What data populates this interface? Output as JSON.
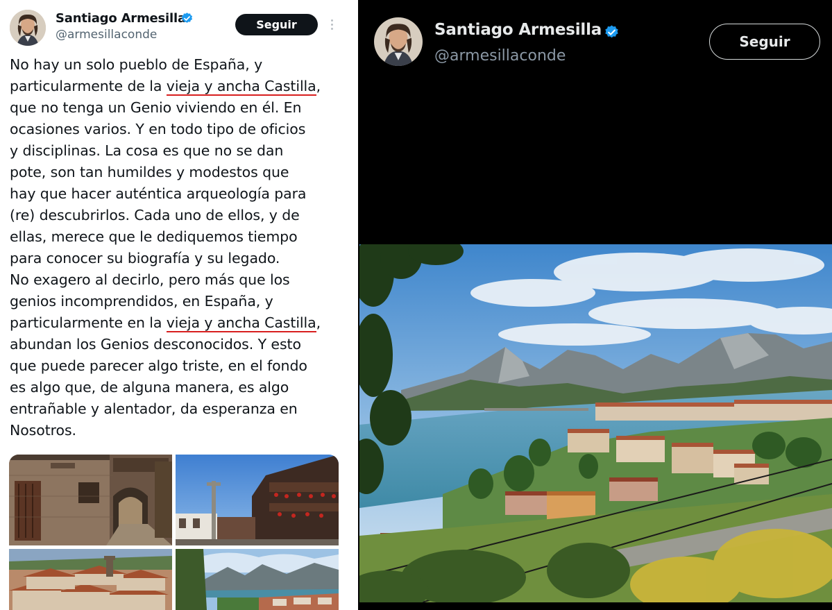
{
  "left_tweet": {
    "author_name": "Santiago Armesilla",
    "handle": "@armesillaconde",
    "follow_label": "Seguir",
    "text_lines": [
      {
        "a": "No hay un solo pueblo de España, y",
        "u": "",
        "b": ""
      },
      {
        "a": "particularmente de la ",
        "u": "vieja y ancha Castilla",
        "b": ","
      },
      {
        "a": "que no tenga un Genio viviendo en él. En",
        "u": "",
        "b": ""
      },
      {
        "a": "ocasiones varios. Y en todo tipo de oficios",
        "u": "",
        "b": ""
      },
      {
        "a": "y disciplinas. La cosa es que no se dan",
        "u": "",
        "b": ""
      },
      {
        "a": "pote, son tan humildes y modestos que",
        "u": "",
        "b": ""
      },
      {
        "a": "hay que hacer auténtica arqueología para",
        "u": "",
        "b": ""
      },
      {
        "a": "(re) descubrirlos. Cada uno de ellos, y de",
        "u": "",
        "b": ""
      },
      {
        "a": "ellas, merece que le dediquemos tiempo",
        "u": "",
        "b": ""
      },
      {
        "a": "para conocer su biografía y su legado.",
        "u": "",
        "b": ""
      },
      {
        "a": "No exagero al decirlo, pero más que los",
        "u": "",
        "b": ""
      },
      {
        "a": "genios incomprendidos, en España, y",
        "u": "",
        "b": ""
      },
      {
        "a": "particularmente en la ",
        "u": "vieja y ancha Castilla",
        "b": ","
      },
      {
        "a": "abundan los Genios desconocidos. Y esto",
        "u": "",
        "b": ""
      },
      {
        "a": "que puede parecer algo triste, en el fondo",
        "u": "",
        "b": ""
      },
      {
        "a": "es algo que, de alguna manera, es algo",
        "u": "",
        "b": ""
      },
      {
        "a": "entrañable y alentador, da esperanza en",
        "u": "",
        "b": ""
      },
      {
        "a": "Nosotros.",
        "u": "",
        "b": ""
      }
    ],
    "media_icons": [
      "stone-village-photo",
      "balcony-street-photo",
      "rooftops-photo",
      "lake-mountain-photo"
    ]
  },
  "right_tweet": {
    "author_name": "Santiago Armesilla",
    "handle": "@armesillaconde",
    "follow_label": "Seguir",
    "media_icon": "mountain-lake-village-photo"
  },
  "colors": {
    "verified": "#1d9bf0",
    "underline": "#d81e1e",
    "light_bg": "#ffffff",
    "dark_bg": "#000000"
  }
}
